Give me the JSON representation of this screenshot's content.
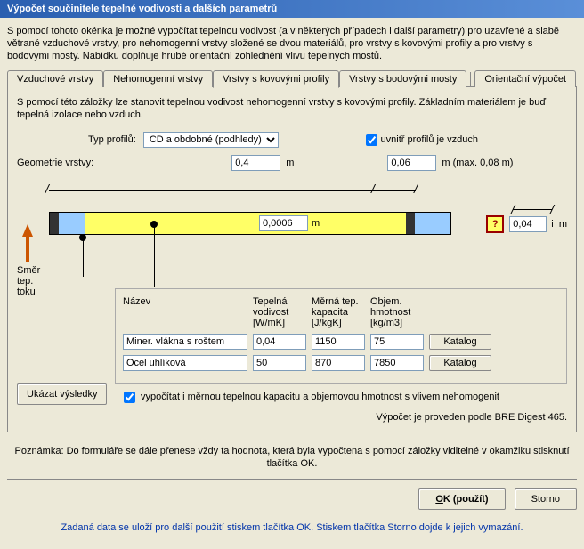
{
  "title": "Výpočet součinitele tepelné vodivosti a dalších parametrů",
  "intro": "S pomocí tohoto okénka je možné vypočítat tepelnou vodivost (a v některých případech i další parametry) pro uzavřené a slabě větrané vzduchové vrstvy, pro nehomogenní vrstvy složené se dvou materiálů, pro vrstvy s kovovými profily a pro vrstvy s bodovými mosty. Nabídku doplňuje hrubé orientační zohlednění vlivu tepelných mostů.",
  "tabs": {
    "t0": "Vzduchové vrstvy",
    "t1": "Nehomogenní vrstvy",
    "t2": "Vrstvy s kovovými profily",
    "t3": "Vrstvy s bodovými mosty",
    "t4": "Orientační výpočet"
  },
  "panel": {
    "intro": "S pomocí této záložky lze stanovit tepelnou vodivost nehomogenní vrstvy s kovovými profily. Základním materiálem je buď tepelná izolace nebo vzduch.",
    "typ_label": "Typ profilů:",
    "typ_value": "CD a obdobné (podhledy)",
    "uvnitr_label": "uvnitř profilů je vzduch",
    "uvnitr_checked": true,
    "geom_label": "Geometrie vrstvy:",
    "width_value": "0,4",
    "width_unit": "m",
    "height_value": "0,06",
    "height_unit": "m (max. 0,08 m)",
    "gap_value": "0,0006",
    "gap_unit": "m",
    "side_value": "0,04",
    "side_unit": "i  m",
    "smer": "Směr\ntep.\ntoku",
    "help": "?",
    "mat_headers": {
      "name": "Název",
      "cond": "Tepelná\nvodivost\n[W/mK]",
      "cap": "Měrná tep.\nkapacita\n[J/kgK]",
      "dens": "Objem.\nhmotnost\n[kg/m3]"
    },
    "materials": [
      {
        "name": "Miner. vlákna s roštem",
        "cond": "0,04",
        "cap": "1150",
        "dens": "75"
      },
      {
        "name": "Ocel uhlíková",
        "cond": "50",
        "cap": "870",
        "dens": "7850"
      }
    ],
    "katalog": "Katalog",
    "calc_checkbox": "vypočítat i měrnou tepelnou kapacitu a objemovou hmotnost s vlivem nehomogenit",
    "show_results": "Ukázat výsledky",
    "bre": "Výpočet je proveden podle BRE Digest 465."
  },
  "note": "Poznámka: Do formuláře se dále přenese vždy ta hodnota, která byla vypočtena s pomocí záložky viditelné v okamžiku stisknutí tlačítka OK.",
  "buttons": {
    "ok": "OK (použít)",
    "cancel": "Storno"
  },
  "footer": "Zadaná data se uloží pro další použití stiskem tlačítka OK. Stiskem tlačítka Storno dojde k jejich vymazání."
}
